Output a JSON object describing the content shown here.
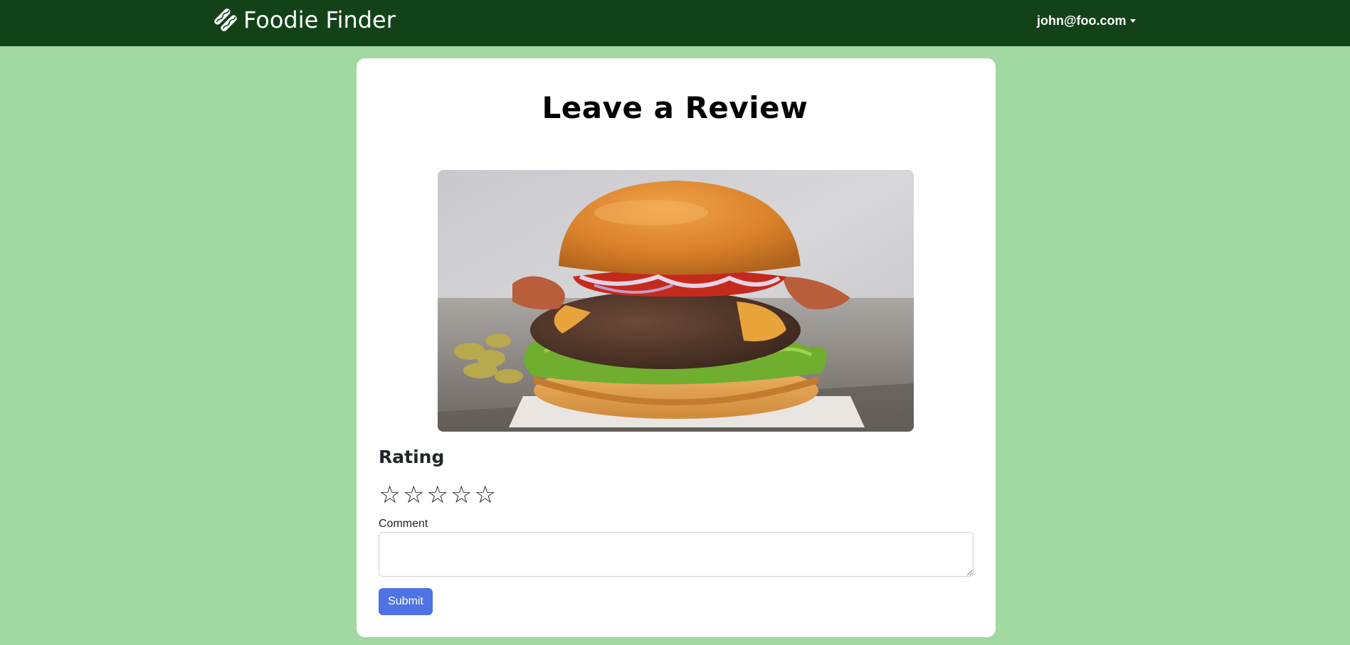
{
  "navbar": {
    "brand_text": "Foodie Finder",
    "brand_icon": "hotdog-icon",
    "user_email": "john@foo.com"
  },
  "page": {
    "title": "Leave a Review"
  },
  "image": {
    "subject": "burger-photo"
  },
  "form": {
    "rating_label": "Rating",
    "stars": [
      "☆",
      "☆",
      "☆",
      "☆",
      "☆"
    ],
    "rating_value": 0,
    "rating_max": 5,
    "comment_label": "Comment",
    "comment_value": "",
    "submit_label": "Submit"
  },
  "colors": {
    "navbar_bg": "#134219",
    "page_bg": "#a2d8a2",
    "card_bg": "#ffffff",
    "submit_bg": "#4f73e3"
  }
}
